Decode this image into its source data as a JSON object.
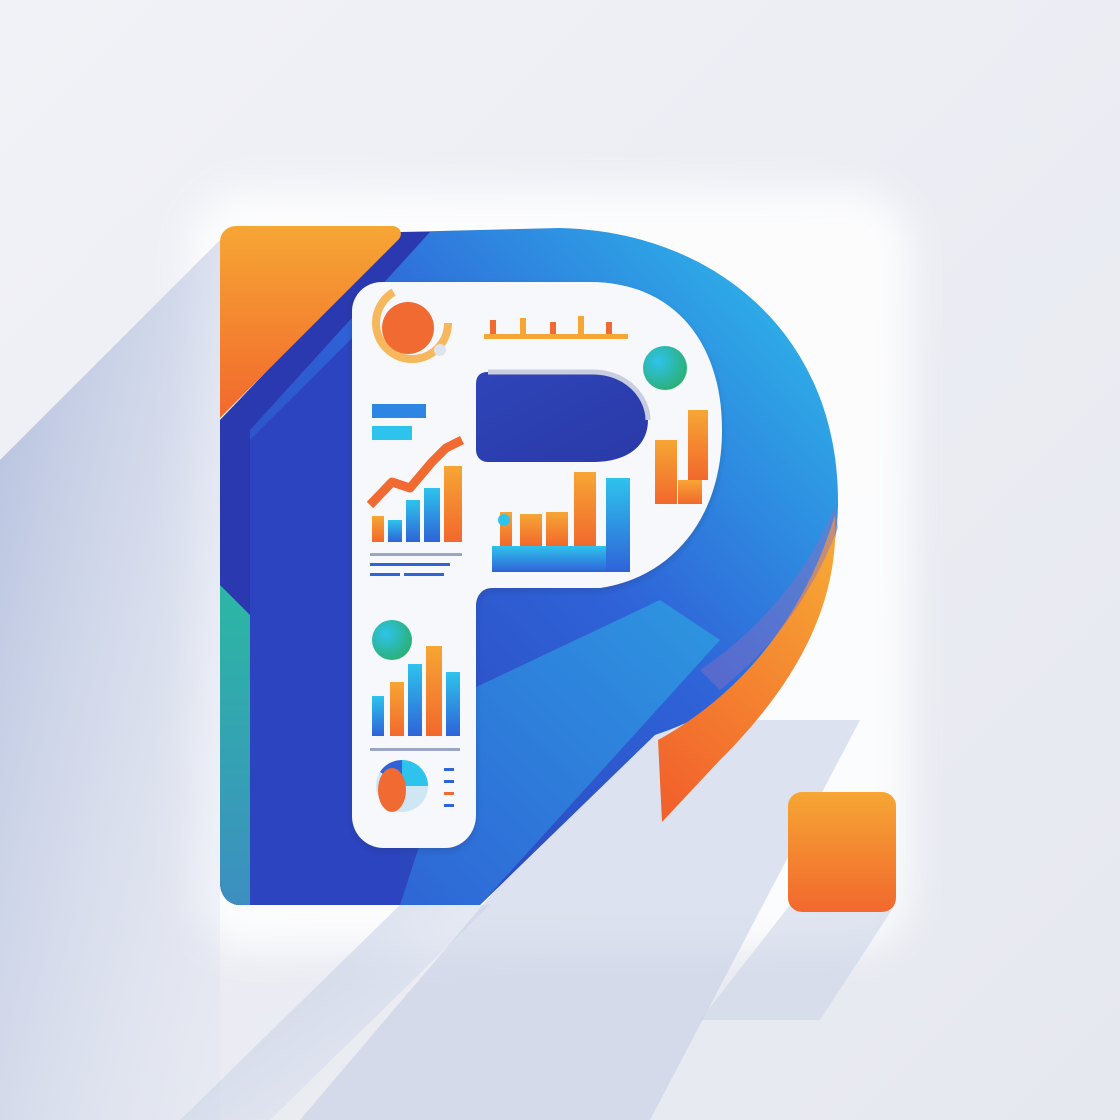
{
  "logo": {
    "letter": "P",
    "style": "flat gradient analytics logomark",
    "colors": {
      "background": "#eef0f6",
      "blue_dark": "#2a39b0",
      "blue_mid": "#2f63d8",
      "cyan": "#2ec3ec",
      "teal": "#2bb7a4",
      "orange": "#f5862b",
      "orange_light": "#f6a634",
      "orange_deep": "#f2682d",
      "panel": "#f7f8fb"
    },
    "icons": [
      "donut-chart-icon",
      "trend-line-icon",
      "bar-chart-icon",
      "pie-chart-icon",
      "legend-lines-icon",
      "circle-dot-icon",
      "period-square"
    ]
  }
}
